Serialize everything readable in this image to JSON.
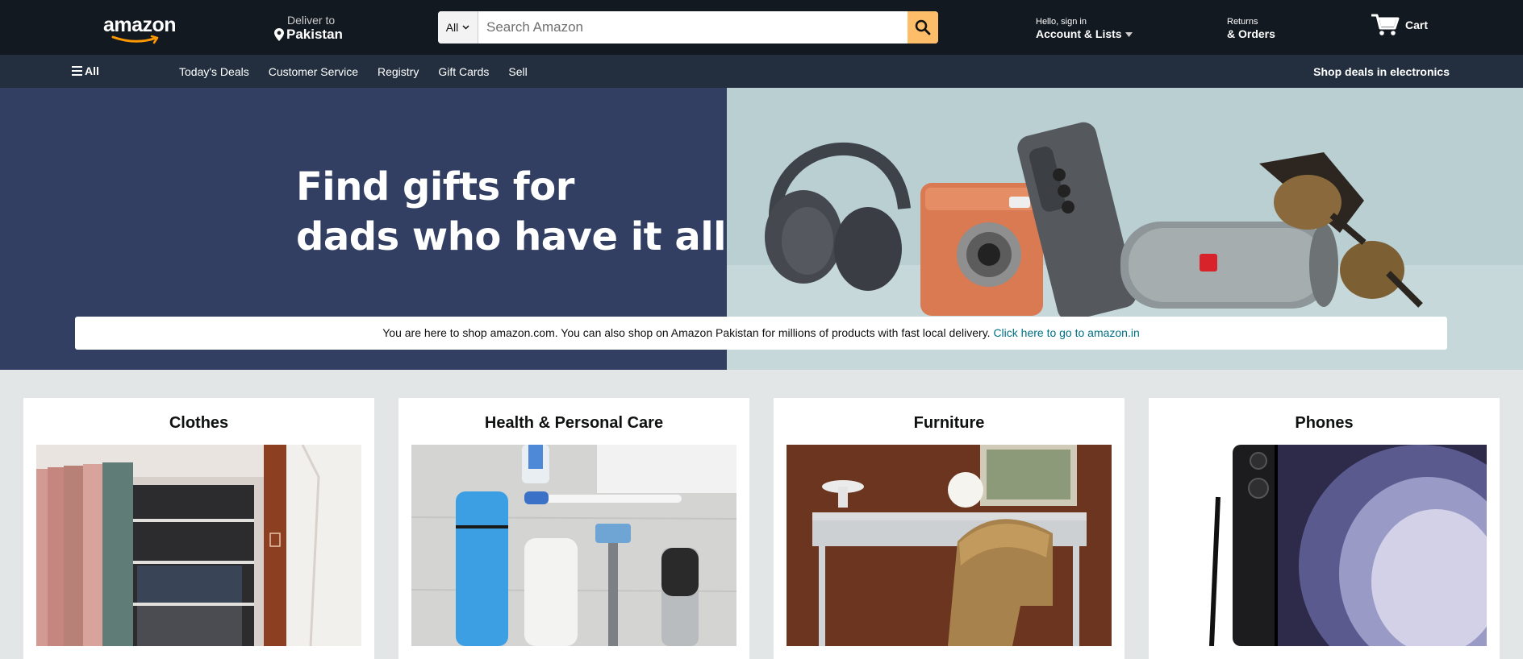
{
  "header": {
    "logo": "amazon",
    "deliver_to_label": "Deliver to",
    "deliver_to_location": "Pakistan",
    "search_category": "All",
    "search_placeholder": "Search Amazon",
    "account_greeting": "Hello, sign in",
    "account_label": "Account & Lists",
    "returns_line1": "Returns",
    "returns_line2": "& Orders",
    "cart_label": "Cart"
  },
  "nav": {
    "all_label": "All",
    "links": [
      "Today's Deals",
      "Customer Service",
      "Registry",
      "Gift Cards",
      "Sell"
    ],
    "promo": "Shop deals in electronics"
  },
  "hero": {
    "title_line1": "Find gifts for",
    "title_line2": "dads who have it all"
  },
  "notice": {
    "text": "You are here to shop amazon.com. You can also shop on Amazon Pakistan for millions of products with fast local delivery. ",
    "link": "Click here to go to amazon.in"
  },
  "cards": [
    {
      "title": "Clothes"
    },
    {
      "title": "Health & Personal Care"
    },
    {
      "title": "Furniture"
    },
    {
      "title": "Phones"
    }
  ],
  "colors": {
    "header_bg": "#131921",
    "nav_bg": "#232f3e",
    "search_button": "#febd69",
    "logo_smile": "#ff9900",
    "hero_left": "#323f63",
    "hero_right": "#bacfd2",
    "link": "#007185",
    "page_bg": "#e3e6e6"
  }
}
